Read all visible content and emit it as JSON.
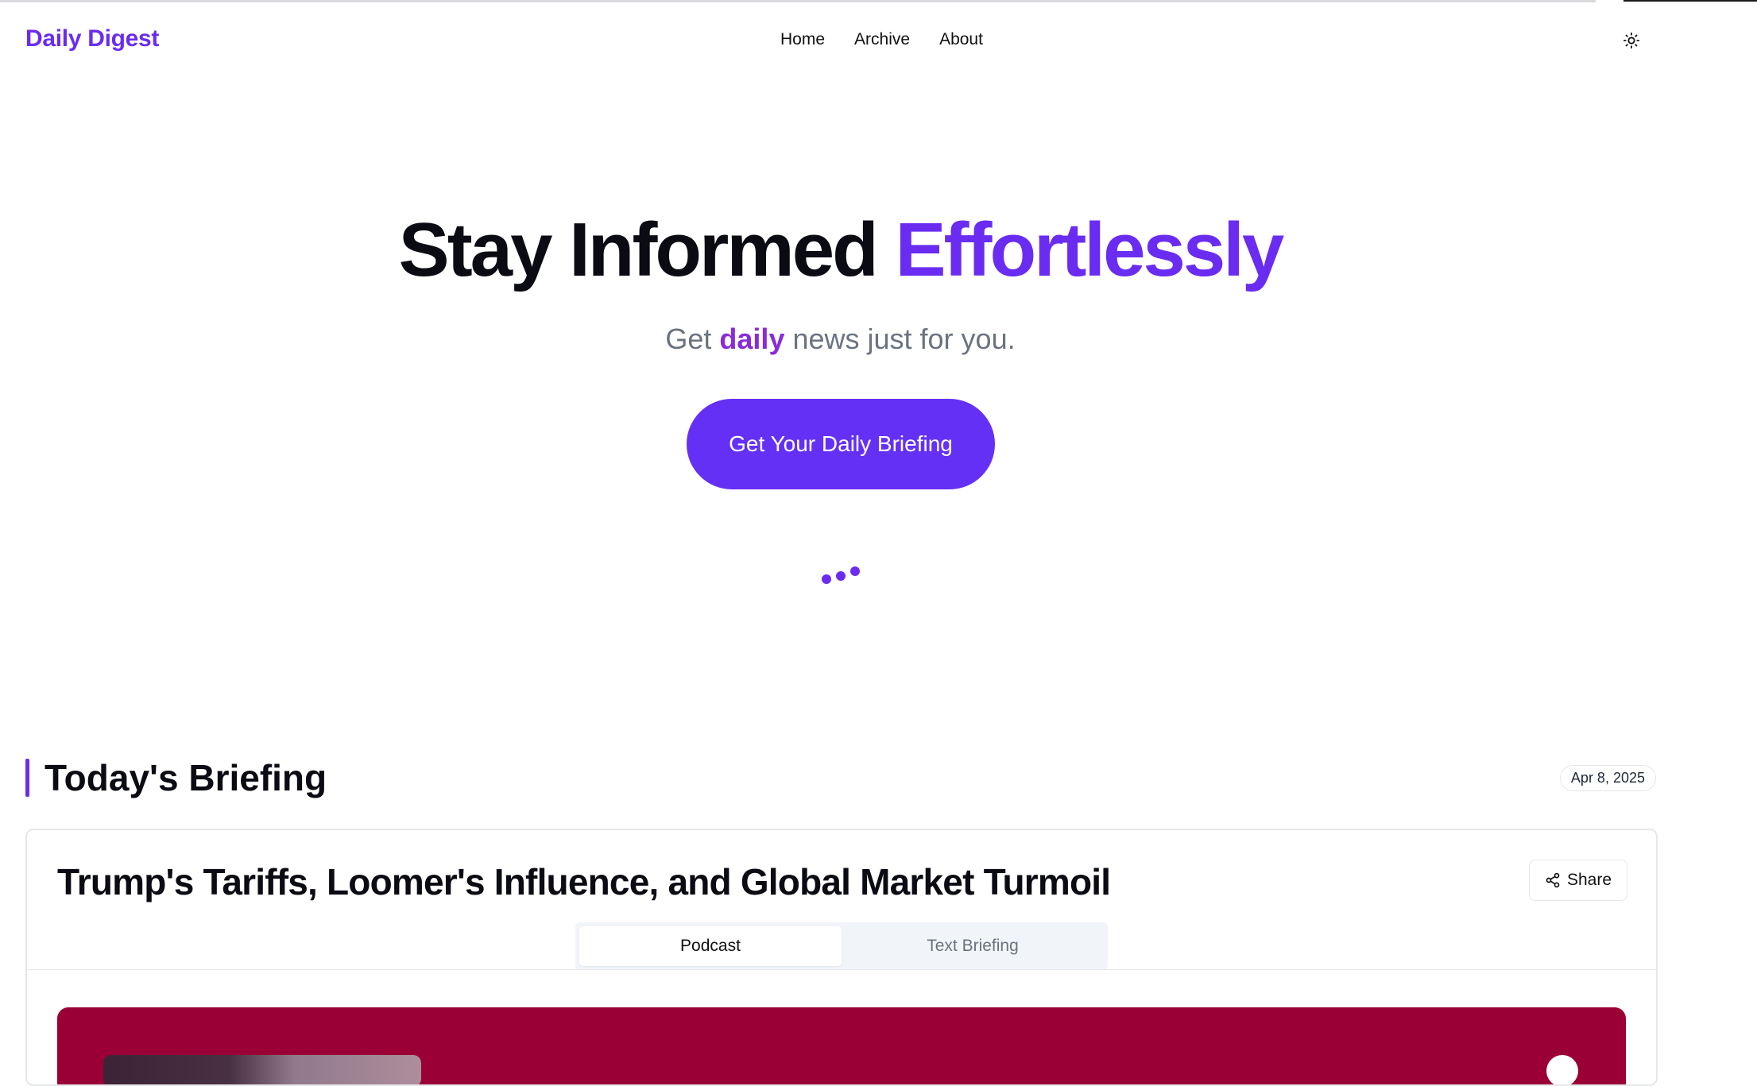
{
  "header": {
    "logo": "Daily Digest",
    "nav": [
      "Home",
      "Archive",
      "About"
    ],
    "theme_icon": "sun-icon"
  },
  "hero": {
    "title_main": "Stay Informed ",
    "title_accent": "Effortlessly",
    "subtitle_pre": "Get ",
    "subtitle_accent": "daily",
    "subtitle_post": " news just for you.",
    "cta_label": "Get Your Daily Briefing"
  },
  "briefing": {
    "section_title": "Today's Briefing",
    "date": "Apr 8, 2025",
    "title": "Trump's Tariffs, Loomer's Influence, and Global Market Turmoil",
    "share_label": "Share",
    "tabs": [
      "Podcast",
      "Text Briefing"
    ],
    "active_tab": "Podcast"
  },
  "colors": {
    "accent": "#6a2cf0",
    "subtitle_accent": "#8a2bd9",
    "player_background": "#9a0036"
  }
}
